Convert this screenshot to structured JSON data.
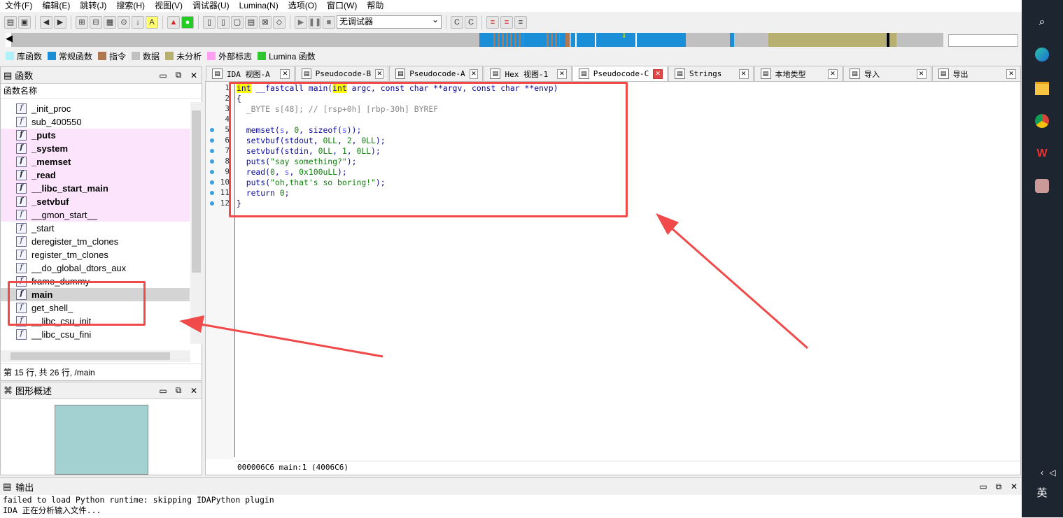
{
  "menu": [
    "文件(F)",
    "编辑(E)",
    "跳转(J)",
    "搜索(H)",
    "视图(V)",
    "调试器(U)",
    "Lumina(N)",
    "选项(O)",
    "窗口(W)",
    "帮助"
  ],
  "toolbar": {
    "debugger_select": "无调试器"
  },
  "legend": [
    {
      "label": "库函数",
      "color": "#b0f0f8"
    },
    {
      "label": "常规函数",
      "color": "#1a8fd8"
    },
    {
      "label": "指令",
      "color": "#b07850"
    },
    {
      "label": "数据",
      "color": "#c0c0c0"
    },
    {
      "label": "未分析",
      "color": "#b8b070"
    },
    {
      "label": "外部标志",
      "color": "#ff9ff3"
    },
    {
      "label": "Lumina 函数",
      "color": "#2ec82e"
    }
  ],
  "functions_panel": {
    "title": "函数",
    "column_header": "函数名称",
    "items": [
      {
        "name": "_init_proc",
        "kind": "normal"
      },
      {
        "name": "sub_400550",
        "kind": "normal"
      },
      {
        "name": "_puts",
        "kind": "lib"
      },
      {
        "name": "_system",
        "kind": "lib"
      },
      {
        "name": "_memset",
        "kind": "lib"
      },
      {
        "name": "_read",
        "kind": "lib"
      },
      {
        "name": "__libc_start_main",
        "kind": "lib"
      },
      {
        "name": "_setvbuf",
        "kind": "lib"
      },
      {
        "name": "__gmon_start__",
        "kind": "gmon"
      },
      {
        "name": "_start",
        "kind": "normal"
      },
      {
        "name": "deregister_tm_clones",
        "kind": "normal"
      },
      {
        "name": "register_tm_clones",
        "kind": "normal"
      },
      {
        "name": "__do_global_dtors_aux",
        "kind": "normal"
      },
      {
        "name": "frame_dummy",
        "kind": "normal"
      },
      {
        "name": "main",
        "kind": "sel"
      },
      {
        "name": "get_shell_",
        "kind": "normal"
      },
      {
        "name": "__libc_csu_init",
        "kind": "normal"
      },
      {
        "name": "__libc_csu_fini",
        "kind": "normal"
      }
    ],
    "status": "第 15 行, 共 26 行, /main"
  },
  "graph_panel": {
    "title": "图形概述"
  },
  "tabs": [
    {
      "label": "IDA 视图-A",
      "icon": "ida-view-icon",
      "active": false
    },
    {
      "label": "Pseudocode-B",
      "icon": "pseudocode-icon",
      "active": false
    },
    {
      "label": "Pseudocode-A",
      "icon": "pseudocode-icon",
      "active": false
    },
    {
      "label": "Hex 视图-1",
      "icon": "hex-icon",
      "active": false
    },
    {
      "label": "Pseudocode-C",
      "icon": "pseudocode-icon",
      "active": true
    },
    {
      "label": "Strings",
      "icon": "strings-icon",
      "active": false
    },
    {
      "label": "本地类型",
      "icon": "local-types-icon",
      "active": false
    },
    {
      "label": "导入",
      "icon": "imports-icon",
      "active": false
    },
    {
      "label": "导出",
      "icon": "exports-icon",
      "active": false
    }
  ],
  "code": {
    "lines": [
      {
        "n": "1",
        "bp": false,
        "html": "<span class=\"kw\">int</span> __fastcall main(<span class=\"kw\">int</span> argc, const char **argv, const char **envp)"
      },
      {
        "n": "2",
        "bp": false,
        "html": "{"
      },
      {
        "n": "3",
        "bp": false,
        "html": "  <span class=\"cm\">_BYTE s[48]; // [rsp+0h] [rbp-30h] BYREF</span>"
      },
      {
        "n": "4",
        "bp": false,
        "html": ""
      },
      {
        "n": "5",
        "bp": true,
        "html": "  memset(<span class=\"var\">s</span>, <span class=\"num\">0</span>, sizeof(<span class=\"var\">s</span>));"
      },
      {
        "n": "6",
        "bp": true,
        "html": "  setvbuf(stdout, <span class=\"num\">0LL</span>, <span class=\"num\">2</span>, <span class=\"num\">0LL</span>);"
      },
      {
        "n": "7",
        "bp": true,
        "html": "  setvbuf(stdin, <span class=\"num\">0LL</span>, <span class=\"num\">1</span>, <span class=\"num\">0LL</span>);"
      },
      {
        "n": "8",
        "bp": true,
        "html": "  puts(<span class=\"str\">\"say something?\"</span>);"
      },
      {
        "n": "9",
        "bp": true,
        "html": "  read(<span class=\"num\">0</span>, <span class=\"var\">s</span>, <span class=\"num\">0x100uLL</span>);"
      },
      {
        "n": "10",
        "bp": true,
        "html": "  puts(<span class=\"str\">\"oh,that's so boring!\"</span>);"
      },
      {
        "n": "11",
        "bp": true,
        "html": "  return <span class=\"num\">0</span>;"
      },
      {
        "n": "12",
        "bp": true,
        "html": "}"
      }
    ],
    "status": "000006C6 main:1 (4006C6)"
  },
  "output_panel": {
    "title": "输出",
    "lines": [
      "failed to load Python runtime: skipping IDAPython plugin",
      "IDA 正在分析输入文件..."
    ]
  },
  "taskbar": {
    "ime": "英"
  },
  "annotation_color": "#f04a4a"
}
